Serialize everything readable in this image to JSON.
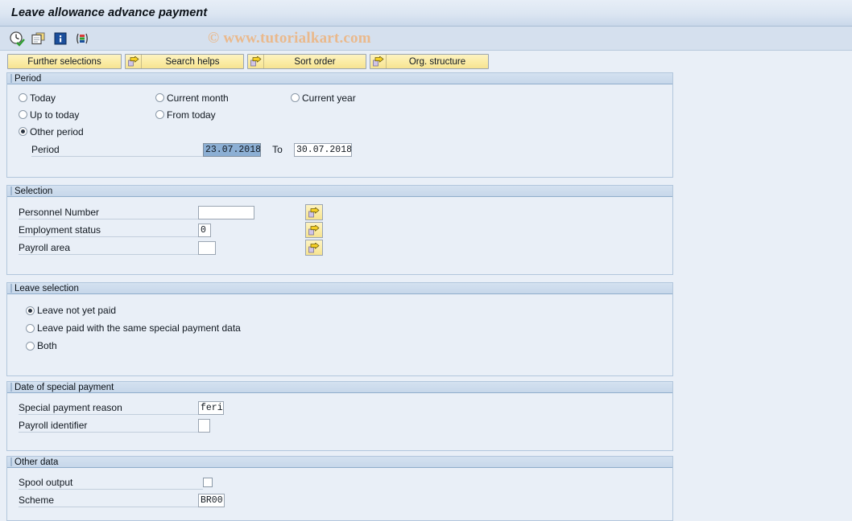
{
  "window": {
    "title": "Leave allowance advance payment"
  },
  "toolbar": {
    "icons": [
      {
        "name": "execute-clock-icon",
        "tip": "Execute"
      },
      {
        "name": "copy-icon",
        "tip": "Copy"
      },
      {
        "name": "info-icon",
        "tip": "Information"
      },
      {
        "name": "variant-icon",
        "tip": "Get variant"
      }
    ],
    "watermark": "© www.tutorialkart.com"
  },
  "button_row": [
    {
      "label": "Further selections",
      "icon": null,
      "width": 142
    },
    {
      "label": "Search helps",
      "icon": "arrow-right-icon",
      "width": 148
    },
    {
      "label": "Sort order",
      "icon": "arrow-right-icon",
      "width": 148
    },
    {
      "label": "Org. structure",
      "icon": "arrow-right-icon",
      "width": 148
    }
  ],
  "sections": {
    "period": {
      "title": "Period",
      "options": [
        {
          "label": "Today",
          "selected": false
        },
        {
          "label": "Current month",
          "selected": false
        },
        {
          "label": "Current year",
          "selected": false
        },
        {
          "label": "Up to today",
          "selected": false
        },
        {
          "label": "From today",
          "selected": false
        },
        {
          "label": "Other period",
          "selected": true
        }
      ],
      "period_label": "Period",
      "period_from": "23.07.2018",
      "to_label": "To",
      "period_to": "30.07.2018"
    },
    "selection": {
      "title": "Selection",
      "fields": [
        {
          "label": "Personnel Number",
          "value": "",
          "width": 70
        },
        {
          "label": "Employment status",
          "value": "0",
          "width": 16
        },
        {
          "label": "Payroll area",
          "value": "",
          "width": 22
        }
      ]
    },
    "leave_selection": {
      "title": "Leave selection",
      "options": [
        {
          "label": "Leave not yet paid",
          "selected": true
        },
        {
          "label": "Leave paid with the same special payment data",
          "selected": false
        },
        {
          "label": "Both",
          "selected": false
        }
      ]
    },
    "date_of_special_payment": {
      "title": "Date of special payment",
      "fields": [
        {
          "label": "Special payment reason",
          "value": "feri",
          "width": 32
        },
        {
          "label": "Payroll identifier",
          "value": "",
          "width": 15
        }
      ]
    },
    "other_data": {
      "title": "Other data",
      "spool_label": "Spool output",
      "spool_checked": false,
      "scheme_label": "Scheme",
      "scheme_value": "BR00"
    }
  },
  "colors": {
    "background": "#e9eff7",
    "panel_header": "#c7d7ea",
    "button_yellow": "#fbeca6",
    "selection_highlight": "#8cafd4",
    "watermark": "#eab98c"
  }
}
